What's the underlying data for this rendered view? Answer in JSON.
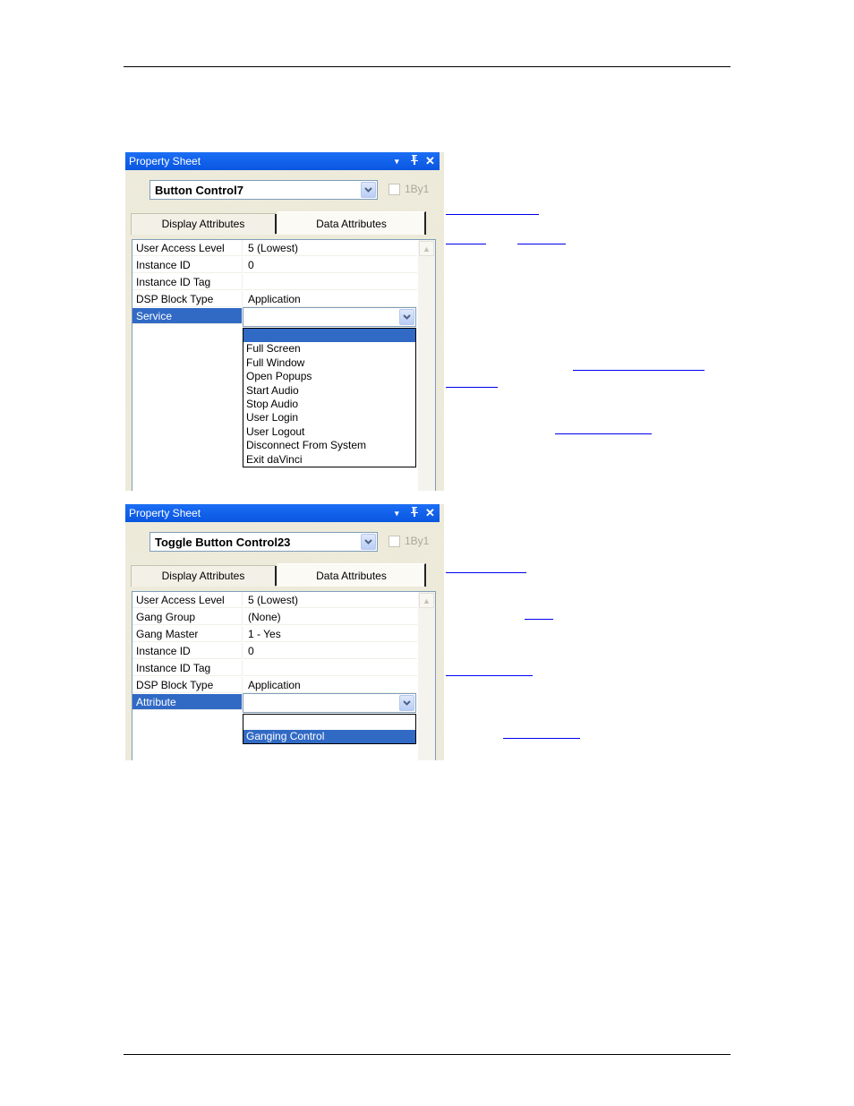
{
  "document": {
    "header_rule": true,
    "footer_rule": true
  },
  "panels": [
    {
      "title": "Property Sheet",
      "title_controls": [
        "dropdown-arrow-icon",
        "pin-icon",
        "close-icon"
      ],
      "object_select": {
        "value": "Button Control7"
      },
      "onebyone": {
        "label": "1By1",
        "checked": false,
        "enabled": false
      },
      "tabs": [
        {
          "label": "Display Attributes",
          "active": false
        },
        {
          "label": "Data Attributes",
          "active": true
        }
      ],
      "properties": [
        {
          "name": "User Access Level",
          "value": "5 (Lowest)"
        },
        {
          "name": "Instance ID",
          "value": "0"
        },
        {
          "name": "Instance ID Tag",
          "value": ""
        },
        {
          "name": "DSP Block Type",
          "value": "Application"
        },
        {
          "name": "Service",
          "value": "",
          "selected": true
        }
      ],
      "dropdown": {
        "options": [
          "",
          "Full Screen",
          "Full Window",
          "Open Popups",
          "Start Audio",
          "Stop Audio",
          "User Login",
          "User Logout",
          "Disconnect From System",
          "Exit daVinci"
        ],
        "highlighted_index": 0
      }
    },
    {
      "title": "Property Sheet",
      "title_controls": [
        "dropdown-arrow-icon",
        "pin-icon",
        "close-icon"
      ],
      "object_select": {
        "value": "Toggle Button Control23"
      },
      "onebyone": {
        "label": "1By1",
        "checked": false,
        "enabled": false
      },
      "tabs": [
        {
          "label": "Display Attributes",
          "active": false
        },
        {
          "label": "Data Attributes",
          "active": true
        }
      ],
      "properties": [
        {
          "name": "User Access Level",
          "value": "5 (Lowest)"
        },
        {
          "name": "Gang Group",
          "value": "(None)"
        },
        {
          "name": "Gang Master",
          "value": "1 - Yes"
        },
        {
          "name": "Instance ID",
          "value": "0"
        },
        {
          "name": "Instance ID Tag",
          "value": ""
        },
        {
          "name": "DSP Block Type",
          "value": "Application"
        },
        {
          "name": "Attribute",
          "value": "",
          "selected": true
        }
      ],
      "dropdown": {
        "options": [
          "",
          "Ganging Control"
        ],
        "highlighted_index": 1
      }
    }
  ],
  "icons": {
    "dropdown_arrow": "▾",
    "pin": "⊥",
    "close": "✕",
    "chevron_down": "⌄",
    "scroll_up": "▲"
  }
}
